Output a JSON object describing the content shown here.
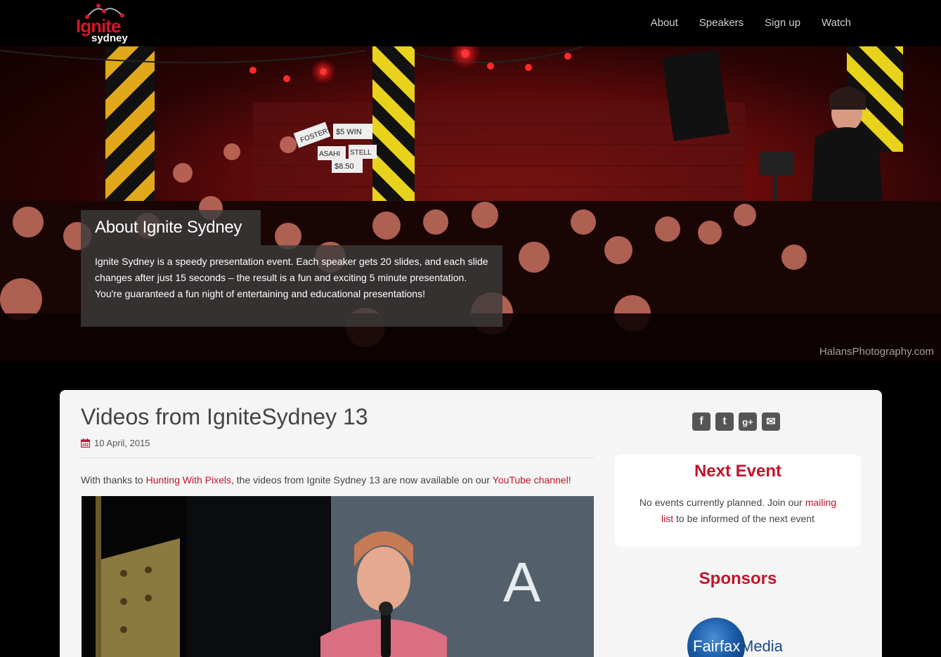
{
  "brand": {
    "name": "Ignite",
    "sub": "sydney"
  },
  "nav": [
    "About",
    "Speakers",
    "Sign up",
    "Watch"
  ],
  "hero": {
    "title": "About Ignite Sydney",
    "body": "Ignite Sydney is a speedy presentation event. Each speaker gets 20 slides, and each slide changes after just 15 seconds – the result is a fun and exciting 5 minute presentation. You're guaranteed a fun night of entertaining and educational presentations!",
    "credit": "HalansPhotography.com",
    "signs": [
      "FOSTERS",
      "$5 WIN",
      "ASAHI",
      "STELL",
      "$8.50"
    ]
  },
  "post": {
    "title": "Videos from IgniteSydney 13",
    "date": "10 April, 2015",
    "text_before": "With thanks to ",
    "link1": "Hunting With Pixels",
    "text_middle": ", the videos from Ignite Sydney 13 are now available on our ",
    "link2": "YouTube channel",
    "text_after": "!",
    "video_letter": "A"
  },
  "social": [
    {
      "icon": "facebook-icon",
      "glyph": "f"
    },
    {
      "icon": "twitter-icon",
      "glyph": "t"
    },
    {
      "icon": "google-plus-icon",
      "glyph": "g+"
    },
    {
      "icon": "email-icon",
      "glyph": "✉"
    }
  ],
  "event": {
    "title": "Next Event",
    "text_before": "No events currently planned. Join our ",
    "link": "mailing list",
    "text_after": " to be informed of the next event"
  },
  "sponsors": {
    "title": "Sponsors",
    "logo_a": "Fairfax",
    "logo_b": "Media"
  },
  "colors": {
    "accent": "#c1142a",
    "nav_bg": "#000000",
    "card_bg": "#f5f5f5"
  }
}
